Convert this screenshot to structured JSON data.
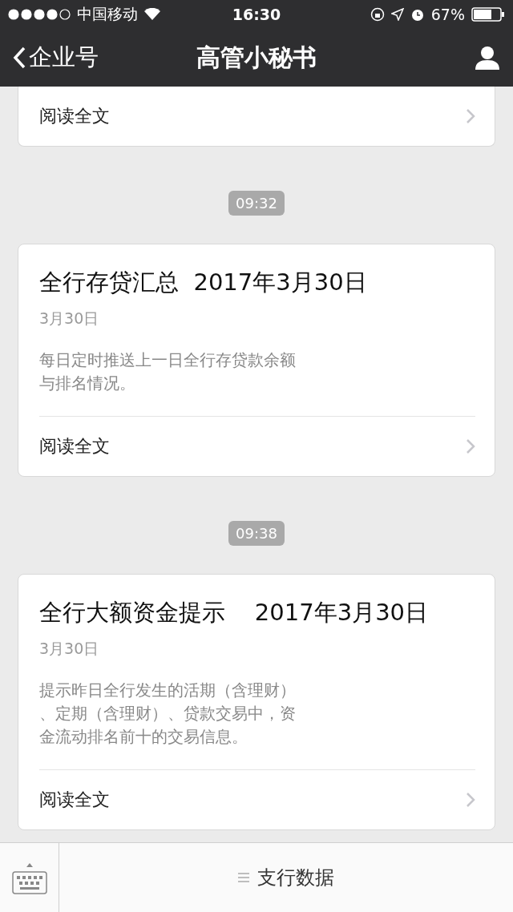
{
  "status_bar": {
    "carrier": "中国移动",
    "time": "16:30",
    "battery": "67%"
  },
  "nav_bar": {
    "back_label": "企业号",
    "title": "高管小秘书"
  },
  "feed": [
    {
      "kind": "partial",
      "read_more": "阅读全文"
    },
    {
      "kind": "timestamp",
      "time": "09:32"
    },
    {
      "kind": "article",
      "title": "全行存贷汇总  2017年3月30日",
      "date": "3月30日",
      "description": [
        "每日定时推送上一日全行存贷款余额",
        "与排名情况。"
      ],
      "read_more": "阅读全文"
    },
    {
      "kind": "timestamp",
      "time": "09:38"
    },
    {
      "kind": "article",
      "title": "全行大额资金提示    2017年3月30日",
      "date": "3月30日",
      "description": [
        "提示昨日全行发生的活期（含理财）",
        "、定期（含理财）、贷款交易中，资",
        "金流动排名前十的交易信息。"
      ],
      "read_more": "阅读全文"
    }
  ],
  "bottom_bar": {
    "menu_label": "支行数据"
  }
}
